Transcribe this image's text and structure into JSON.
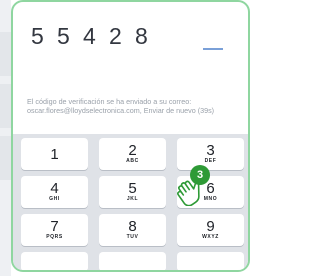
{
  "verification": {
    "code_digits": [
      "5",
      "5",
      "4",
      "2",
      "8"
    ],
    "message": "El código de verificación se ha enviado a su correo: oscar.flores@lloydselectronica.com, Enviar de nuevo (39s)"
  },
  "keypad": {
    "keys": [
      {
        "num": "1",
        "letters": ""
      },
      {
        "num": "2",
        "letters": "ABC"
      },
      {
        "num": "3",
        "letters": "DEF"
      },
      {
        "num": "4",
        "letters": "GHI"
      },
      {
        "num": "5",
        "letters": "JKL"
      },
      {
        "num": "6",
        "letters": "MNO"
      },
      {
        "num": "7",
        "letters": "PQRS"
      },
      {
        "num": "8",
        "letters": "TUV"
      },
      {
        "num": "9",
        "letters": "WXYZ"
      }
    ]
  },
  "annotation": {
    "step": "3",
    "hand_icon": "pointing-hand-icon"
  },
  "colors": {
    "frame_border": "#8fd6a0",
    "badge": "#2e9a36",
    "keypad_bg": "#dfe2e7"
  }
}
